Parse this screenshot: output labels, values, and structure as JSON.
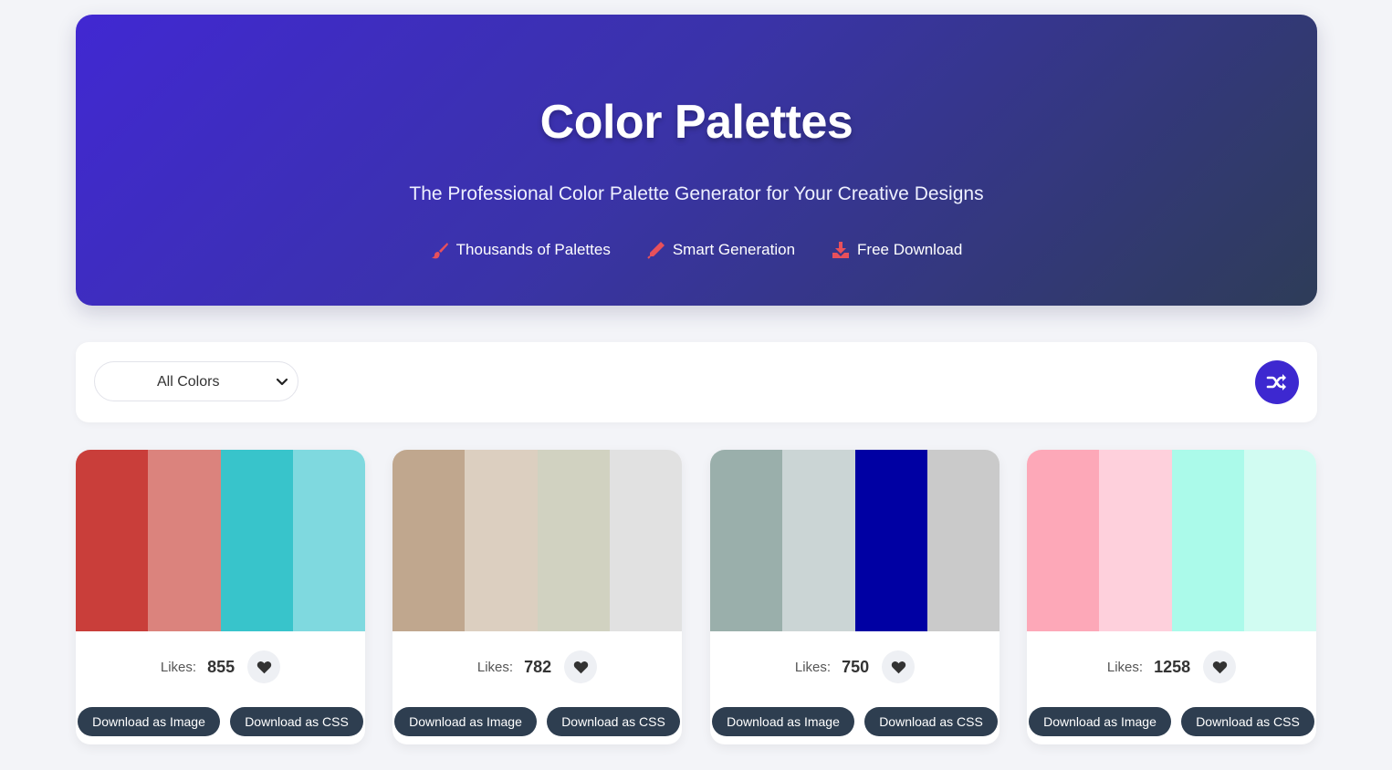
{
  "hero": {
    "title": "Color Palettes",
    "subtitle": "The Professional Color Palette Generator for Your Creative Designs",
    "features": [
      {
        "label": "Thousands of Palettes",
        "icon": "paintbrush-icon"
      },
      {
        "label": "Smart Generation",
        "icon": "pencil-icon"
      },
      {
        "label": "Free Download",
        "icon": "download-icon"
      }
    ],
    "accent": "#e8505b"
  },
  "filter": {
    "selected": "All Colors",
    "shuffle_icon": "shuffle-icon"
  },
  "palettes": [
    {
      "colors": [
        "#c93e3a",
        "#db837d",
        "#38c4cb",
        "#7fd9df"
      ],
      "likes_label": "Likes:",
      "likes": "855",
      "download_image": "Download as Image",
      "download_css": "Download as CSS"
    },
    {
      "colors": [
        "#c0a78e",
        "#dccfc0",
        "#d1d2c1",
        "#e1e1e1"
      ],
      "likes_label": "Likes:",
      "likes": "782",
      "download_image": "Download as Image",
      "download_css": "Download as CSS"
    },
    {
      "colors": [
        "#9aafab",
        "#cbd5d5",
        "#0000a3",
        "#cacaca"
      ],
      "likes_label": "Likes:",
      "likes": "750",
      "download_image": "Download as Image",
      "download_css": "Download as CSS"
    },
    {
      "colors": [
        "#fda8b8",
        "#fed0dc",
        "#abfaea",
        "#d1fcf2"
      ],
      "likes_label": "Likes:",
      "likes": "1258",
      "download_image": "Download as Image",
      "download_css": "Download as CSS"
    }
  ]
}
